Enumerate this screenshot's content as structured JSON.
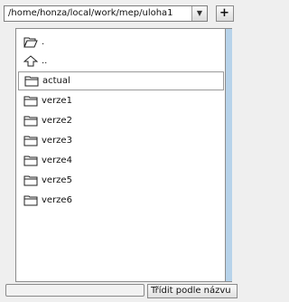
{
  "path_combo": {
    "value": "/home/honza/local/work/mep/uloha1",
    "dropdown_icon": "chevron-down-icon"
  },
  "add_button": {
    "label": "+"
  },
  "file_list": {
    "items": [
      {
        "label": ".",
        "icon": "open-folder-icon"
      },
      {
        "label": "..",
        "icon": "up-arrow-icon"
      },
      {
        "label": "actual",
        "icon": "folder-icon",
        "selected": true
      },
      {
        "label": "verze1",
        "icon": "folder-icon"
      },
      {
        "label": "verze2",
        "icon": "folder-icon"
      },
      {
        "label": "verze3",
        "icon": "folder-icon"
      },
      {
        "label": "verze4",
        "icon": "folder-icon"
      },
      {
        "label": "verze5",
        "icon": "folder-icon"
      },
      {
        "label": "verze6",
        "icon": "folder-icon"
      }
    ]
  },
  "status_bar": {
    "sort_label": "Třídit podle názvu"
  },
  "colors": {
    "side_panel": "#b7d3ea",
    "list_background": "#ffffff",
    "window_background": "#efefef"
  }
}
